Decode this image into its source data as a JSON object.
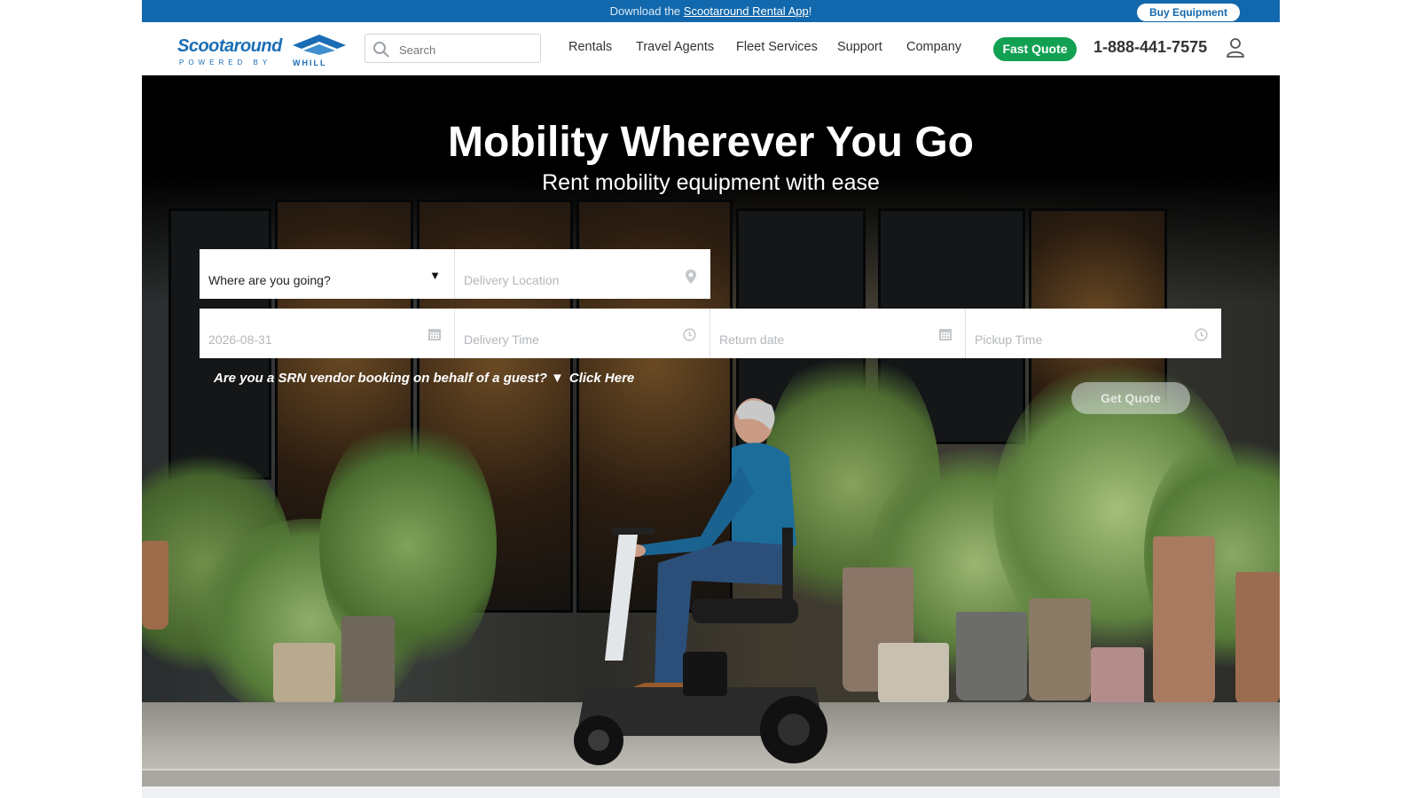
{
  "banner": {
    "prefix": "Download the ",
    "link": "Scootaround Rental App",
    "suffix": "!",
    "buy_button": "Buy Equipment"
  },
  "brand": {
    "name": "Scootaround",
    "tagline": "POWERED BY",
    "partner": "WHILL"
  },
  "search": {
    "placeholder": "Search"
  },
  "nav": {
    "items": [
      "Rentals",
      "Travel Agents",
      "Fleet Services",
      "Support",
      "Company"
    ],
    "quote_button": "Fast Quote",
    "phone": "1-888-441-7575"
  },
  "hero": {
    "title": "Mobility Wherever You Go",
    "subtitle": "Rent mobility equipment with ease"
  },
  "form": {
    "destination": "Where are you going?",
    "delivery_location_placeholder": "Delivery Location",
    "delivery_date_placeholder": "2026-08-31",
    "delivery_time_placeholder": "Delivery Time",
    "return_date_placeholder": "Return date",
    "pickup_time_placeholder": "Pickup Time",
    "vendor_question": "Are you a SRN vendor booking on behalf of a guest? ▼",
    "vendor_link": "Click Here",
    "submit_label": "Get Quote"
  },
  "colors": {
    "brand_blue": "#1268ad",
    "quote_green": "#12a152"
  },
  "icons": [
    "search-icon",
    "user-icon",
    "map-pin-icon",
    "calendar-icon",
    "clock-icon",
    "dropdown-arrow-icon"
  ]
}
